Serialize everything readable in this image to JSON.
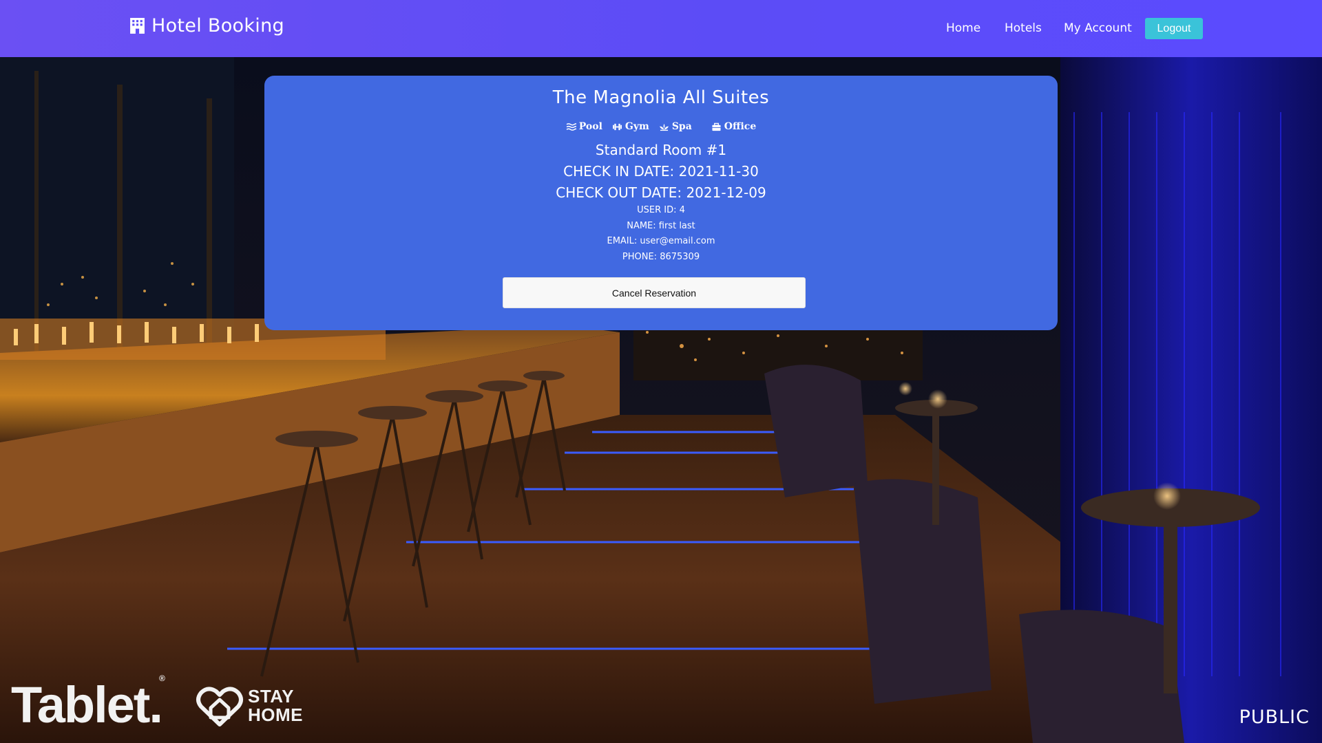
{
  "nav": {
    "brand": "Hotel Booking",
    "links": {
      "home": "Home",
      "hotels": "Hotels",
      "account": "My Account"
    },
    "logout": "Logout"
  },
  "reservation": {
    "hotel_name": "The Magnolia All Suites",
    "amenities": [
      "Pool",
      "Gym",
      "Spa",
      "Office"
    ],
    "room": "Standard Room #1",
    "check_in": "CHECK IN DATE: 2021-11-30",
    "check_out": "CHECK OUT DATE: 2021-12-09",
    "user_id": "USER ID: 4",
    "name": "NAME: first last",
    "email": "EMAIL: user@email.com",
    "phone": "PHONE: 8675309",
    "cancel_label": "Cancel Reservation"
  },
  "watermarks": {
    "tablet": "Tablet.",
    "registered": "®",
    "stay": "STAY",
    "home": "HOME",
    "public": "PUBLIC"
  },
  "colors": {
    "navbar": "#5c4cf6",
    "card": "#4169e1",
    "logout": "#3ac3d9"
  }
}
